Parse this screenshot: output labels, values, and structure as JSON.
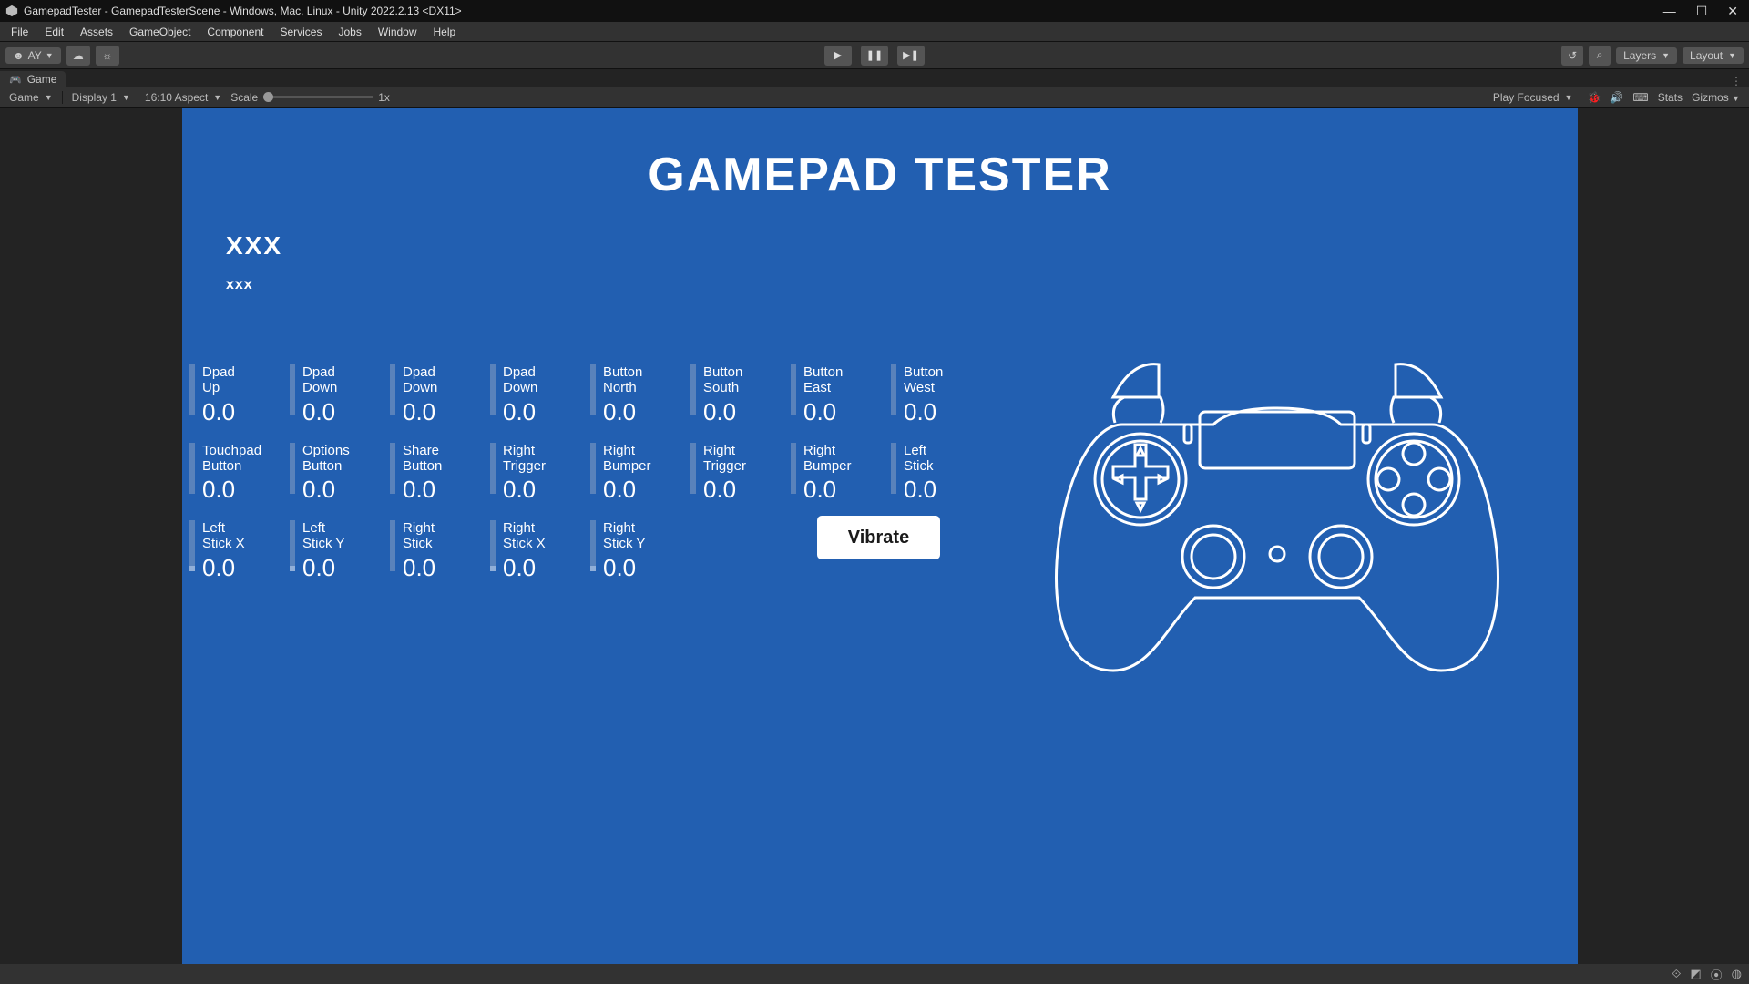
{
  "titlebar": {
    "text": "GamepadTester - GamepadTesterScene - Windows, Mac, Linux - Unity 2022.2.13 <DX11>"
  },
  "menu": [
    "File",
    "Edit",
    "Assets",
    "GameObject",
    "Component",
    "Services",
    "Jobs",
    "Window",
    "Help"
  ],
  "toolbar": {
    "account": "AY",
    "layers": "Layers",
    "layout": "Layout"
  },
  "tab": {
    "name": "Game"
  },
  "gv": {
    "mode": "Game",
    "display": "Display 1",
    "aspect": "16:10 Aspect",
    "scale_label": "Scale",
    "scale_value": "1x",
    "playfocus": "Play Focused",
    "stats": "Stats",
    "gizmos": "Gizmos"
  },
  "app": {
    "title": "GAMEPAD TESTER",
    "header1": "XXX",
    "header2": "xxx",
    "vibrate": "Vibrate"
  },
  "rows": [
    [
      {
        "label": "Dpad\nUp",
        "value": "0.0",
        "fill": 0
      },
      {
        "label": "Dpad\nDown",
        "value": "0.0",
        "fill": 0
      },
      {
        "label": "Dpad\nDown",
        "value": "0.0",
        "fill": 0
      },
      {
        "label": "Dpad\nDown",
        "value": "0.0",
        "fill": 0
      },
      {
        "label": "Button\nNorth",
        "value": "0.0",
        "fill": 0
      },
      {
        "label": "Button\nSouth",
        "value": "0.0",
        "fill": 0
      },
      {
        "label": "Button\nEast",
        "value": "0.0",
        "fill": 0
      },
      {
        "label": "Button\nWest",
        "value": "0.0",
        "fill": 0
      }
    ],
    [
      {
        "label": "Touchpad\nButton",
        "value": "0.0",
        "fill": 0
      },
      {
        "label": "Options\nButton",
        "value": "0.0",
        "fill": 0
      },
      {
        "label": "Share\nButton",
        "value": "0.0",
        "fill": 0
      },
      {
        "label": "Right\nTrigger",
        "value": "0.0",
        "fill": 0
      },
      {
        "label": "Right\nBumper",
        "value": "0.0",
        "fill": 0
      },
      {
        "label": "Right\nTrigger",
        "value": "0.0",
        "fill": 0
      },
      {
        "label": "Right\nBumper",
        "value": "0.0",
        "fill": 0
      },
      {
        "label": "Left\nStick",
        "value": "0.0",
        "fill": 0
      }
    ],
    [
      {
        "label": "Left\nStick X",
        "value": "0.0",
        "fill": 10
      },
      {
        "label": "Left\nStick Y",
        "value": "0.0",
        "fill": 10
      },
      {
        "label": "Right\nStick",
        "value": "0.0",
        "fill": 0
      },
      {
        "label": "Right\nStick X",
        "value": "0.0",
        "fill": 10
      },
      {
        "label": "Right\nStick Y",
        "value": "0.0",
        "fill": 10
      }
    ]
  ]
}
